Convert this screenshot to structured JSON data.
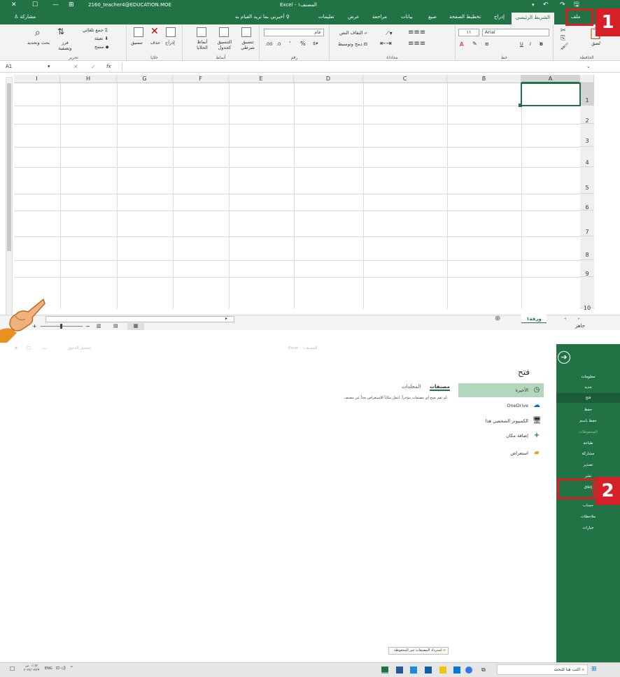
{
  "top": {
    "titlebar": {
      "doc_title": "Excel - المصنف١",
      "account": "2160_teacher4@EDUCATION.MOE"
    },
    "tabs": {
      "file": "ملف",
      "home": "الشريط الرئيسي",
      "insert": "إدراج",
      "page_layout": "تخطيط الصفحة",
      "formulas": "صيغ",
      "data": "بيانات",
      "review": "مراجعة",
      "view": "عرض",
      "help": "تعليمات",
      "tell_me": "أخبرني بما تريد القيام به",
      "share": "مشاركة"
    },
    "ribbon": {
      "clipboard": {
        "paste": "لصق",
        "label": "الحافظة"
      },
      "font": {
        "name": "Arial",
        "size": "١١",
        "bold": "B",
        "italic": "I",
        "underline": "U",
        "grow": "A˄",
        "shrink": "A˅",
        "color": "A",
        "label": "خط"
      },
      "alignment": {
        "wrap": "التفاف النص",
        "merge": "دمج وتوسيط",
        "label": "محاذاة"
      },
      "number": {
        "format": "عام",
        "percent": "%",
        "comma": "٬",
        "label": "رقم"
      },
      "styles": {
        "conditional": "تنسيق شرطي",
        "table": "التنسيق كجدول",
        "cell_styles": "أنماط الخلايا",
        "label": "أنماط"
      },
      "cells": {
        "insert": "إدراج",
        "delete": "حذف",
        "format": "تنسيق",
        "label": "خلايا"
      },
      "editing": {
        "autosum": "جمع تلقائي",
        "fill": "تعبئة",
        "clear": "مسح",
        "sort": "فرز وتصفية",
        "find": "بحث وتحديد",
        "label": "تحرير"
      }
    },
    "formula_bar": {
      "name_box": "A1",
      "fx": "fx",
      "cancel": "✕",
      "enter": "✓",
      "value": ""
    },
    "columns": [
      "A",
      "B",
      "C",
      "D",
      "E",
      "F",
      "G",
      "H",
      "I"
    ],
    "rows": [
      "1",
      "2",
      "3",
      "4",
      "5",
      "6",
      "7",
      "8",
      "9",
      "10"
    ],
    "sheet_tab": "ورقة١",
    "status": {
      "ready": "جاهز"
    },
    "badge": "1"
  },
  "bottom": {
    "sidebar": {
      "items": [
        "معلومات",
        "جديد",
        "فتح",
        "حفظ",
        "حفظ باسم",
        "المحفوظات",
        "طباعة",
        "مشاركة",
        "تصدير",
        "نشر",
        "إغلاق",
        "حساب",
        "ملاحظات",
        "خيارات"
      ]
    },
    "page_title": "فتح",
    "locations": [
      "الأخيرة",
      "OneDrive",
      "الكمبيوتر الشخصي هذا",
      "إضافة مكان",
      "استعراض"
    ],
    "recent_tabs": {
      "files": "مصنفات",
      "folders": "المجلدات"
    },
    "empty_message": "لم تقم بفتح أي مصنفات مؤخراً. انتقل مكاناً للاستعراض بحثاً عن مصنف.",
    "recover_button": "استرداد المصنفات غير المحفوظة",
    "titlebar": {
      "doc_title": "Excel - المصنف١",
      "signin": "تسجيل الدخول"
    },
    "badge": "2",
    "taskbar": {
      "search": "اكتب هنا للبحث",
      "lang": "ENG",
      "time": "٠١:٤٣ ص",
      "date": "٢٠٢٤/٠٢/٢٩"
    }
  }
}
